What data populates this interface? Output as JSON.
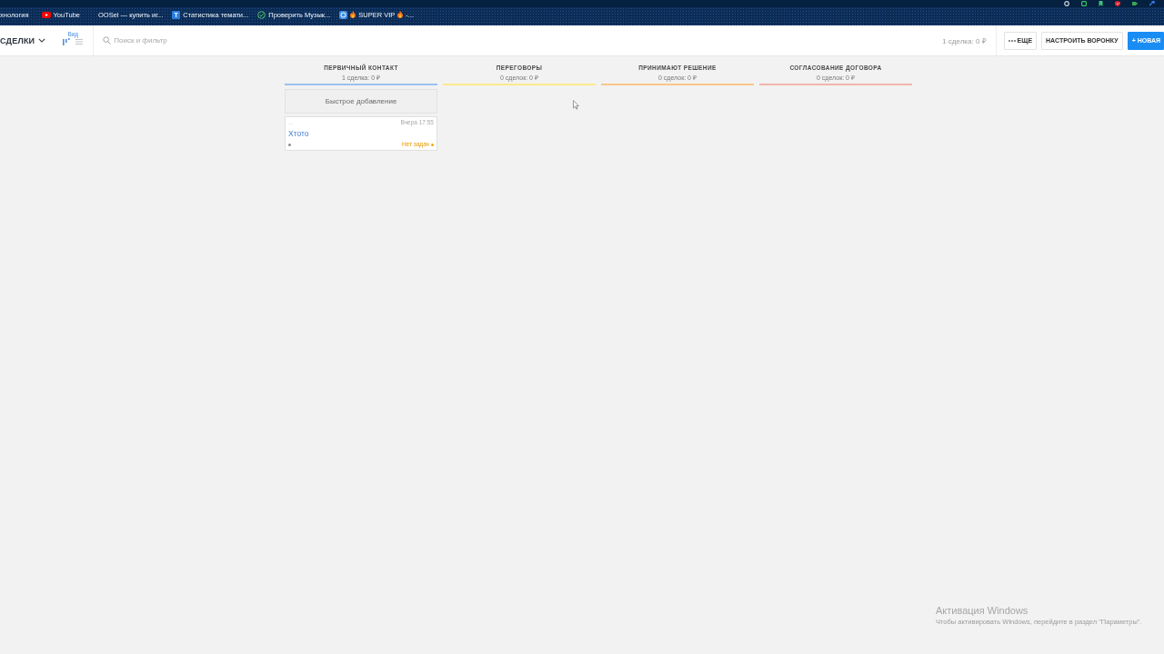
{
  "browser": {
    "bookmarks": [
      {
        "kind": "none",
        "label": "хнология"
      },
      {
        "kind": "youtube",
        "label": "YouTube"
      },
      {
        "kind": "none",
        "label": "OOSel — купить иг..."
      },
      {
        "kind": "letter",
        "icon_letter": "T",
        "label": "Статистика темати..."
      },
      {
        "kind": "check",
        "label": "Проверить Музык..."
      },
      {
        "kind": "tile",
        "fire": true,
        "label": "SUPER VIP",
        "suffix": "-..."
      }
    ]
  },
  "header": {
    "title": "СДЕЛКИ",
    "view_label": "Вид",
    "views": [
      {
        "kind": "pipeline",
        "selected": true
      },
      {
        "kind": "list",
        "selected": false
      }
    ],
    "search": {
      "placeholder": "Поиск и фильтр"
    },
    "summary": "1 сделка: 0 ₽",
    "buttons": [
      {
        "kind": "more",
        "label": "ЕЩЕ"
      },
      {
        "kind": "outline",
        "label": "НАСТРОИТЬ ВОРОНКУ"
      },
      {
        "kind": "primary",
        "label": "+ НОВАЯ"
      }
    ]
  },
  "board": {
    "columns": [
      {
        "title": "ПЕРВИЧНЫЙ КОНТАКТ",
        "summary": "1 сделка: 0 ₽",
        "color": "#99c2ef",
        "quick_add": "Быстрое добавление",
        "cards": [
          {
            "top": "...",
            "time": "Вчера 17:55",
            "name": "Хтото",
            "tasks": "Нет задач"
          }
        ]
      },
      {
        "title": "ПЕРЕГОВОРЫ",
        "summary": "0 сделок: 0 ₽",
        "color": "#fbe98d"
      },
      {
        "title": "ПРИНИМАЮТ РЕШЕНИЕ",
        "summary": "0 сделок: 0 ₽",
        "color": "#f8c88a"
      },
      {
        "title": "СОГЛАСОВАНИЕ ДОГОВОРА",
        "summary": "0 сделок: 0 ₽",
        "color": "#f3b3ab"
      }
    ]
  },
  "os_notice": {
    "title": "Активация Windows",
    "text": "Чтобы активировать Windows, перейдите в раздел \"Параметры\"."
  }
}
